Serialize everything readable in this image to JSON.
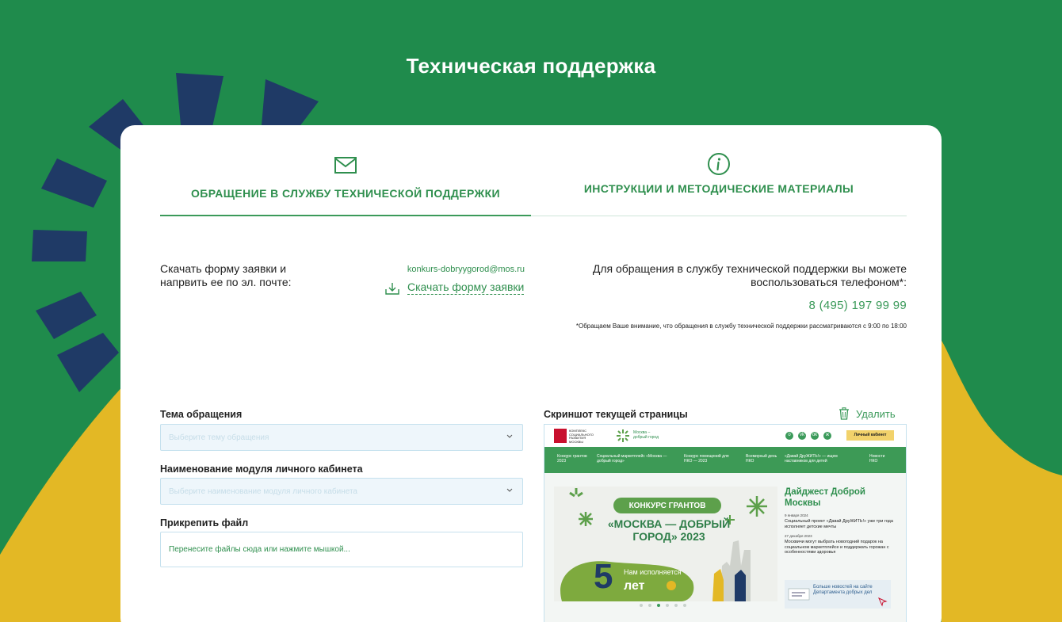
{
  "page": {
    "title": "Техническая поддержка"
  },
  "colors": {
    "bg_green": "#1f8b4c",
    "accent_green": "#2f8f4e",
    "navy": "#1f3a66",
    "yellow": "#e3b825"
  },
  "tabs": [
    {
      "label": "ОБРАЩЕНИЕ В СЛУЖБУ ТЕХНИЧЕСКОЙ ПОДДЕРЖКИ",
      "icon": "envelope-icon",
      "active": true
    },
    {
      "label": "ИНСТРУКЦИИ И МЕТОДИЧЕСКИЕ МАТЕРИАЛЫ",
      "icon": "info-icon",
      "active": false
    }
  ],
  "download": {
    "text": "Скачать форму заявки и напрвить ее по эл. почте:",
    "email": "konkurs-dobryygorod@mos.ru",
    "link_label": "Скачать форму заявки"
  },
  "phone_block": {
    "text": "Для обращения в службу технической поддержки вы можете воспользоваться телефоном*:",
    "phone": "8 (495) 197 99 99",
    "note": "*Обращаем Ваше внимание, что обращения в службу технической поддержки рассматриваются с 9:00 по 18:00"
  },
  "form": {
    "topic_label": "Тема обращения",
    "topic_placeholder": "Выберите тему обращения",
    "module_label": "Наименование модуля личного кабинета",
    "module_placeholder": "Выберите наименование модуля личного кабинета",
    "attach_label": "Прикрепить файл",
    "attach_placeholder": "Перенесите файлы сюда или нажмите мышкой..."
  },
  "screenshot": {
    "label": "Скриншот текущей страницы",
    "delete_label": "Удалить",
    "mini": {
      "logo_text": "КОМПЛЕКС СОЦИАЛЬНОГО РАЗВИТИЯ МОСКВЫ",
      "brand_line1": "Москва –",
      "brand_line2": "добрый город",
      "socials": [
        "o",
        "vk",
        "ok",
        "ж"
      ],
      "cabinet": "Личный кабинет",
      "nav": [
        "Конкурс грантов 2023",
        "Социальный маркетплейс «Москва — добрый город»",
        "Конкурс помещений для НКО — 2023",
        "Всемирный день НКО",
        "«Давай ДруЖИТЬ!» — ищем наставников для детей",
        "Новости НКО"
      ],
      "banner_pill": "КОНКУРС ГРАНТОВ",
      "banner_headline": "«МОСКВА — ДОБРЫЙ ГОРОД» 2023",
      "banner_five": "5",
      "banner_sub": "Нам исполняется",
      "banner_years": "лет",
      "digest_title": "Дайджест Доброй Москвы",
      "news": [
        {
          "date": "9 января 2024",
          "text": "Социальный проект «Давай ДруЖИТЬ!» уже три года исполняет детские мечты"
        },
        {
          "date": "27 декабря 2023",
          "text": "Москвичи могут выбрать новогодний подарок на социальном маркетплейсе и поддержать горожан с особенностями здоровья"
        }
      ],
      "more_news": "Больше новостей на сайте Департамента добрых дел"
    }
  }
}
